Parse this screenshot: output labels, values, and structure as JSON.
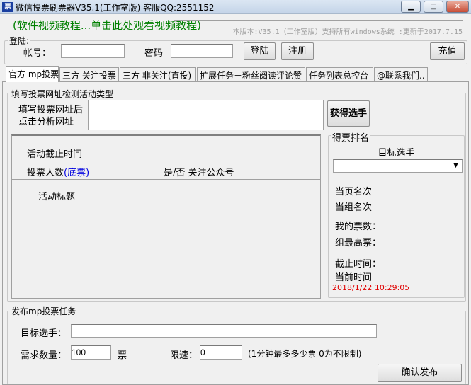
{
  "window": {
    "title": "微信投票刷票器V35.1(工作室版) 客服QQ:2551152",
    "icon": "app-icon",
    "minimize": "minimize-icon",
    "maximize": "maximize-icon",
    "close": "close-icon"
  },
  "header": {
    "video_link": "(软件视频教程...单击此处观看视频教程)",
    "version_note": "本版本:V35.1（工作室版）支持所有windows系统 :更新于2017.7.15"
  },
  "login": {
    "legend": "登陆:",
    "account_label": "帐号：",
    "account_value": "",
    "password_label": "密码",
    "password_value": "",
    "login_button": "登陆",
    "register_button": "注册",
    "recharge_button": "充值"
  },
  "tabs": [
    {
      "label": "官方 mp投票",
      "active": true
    },
    {
      "label": "三方 关注投票"
    },
    {
      "label": "三方 非关注(直投)"
    },
    {
      "label": "扩展任务－粉丝阅读评论赞"
    },
    {
      "label": "任务列表总控台"
    },
    {
      "label": "@联系我们.."
    }
  ],
  "detect": {
    "legend": "填写投票网址检测活动类型",
    "url_label_1": "填写投票网址后",
    "url_label_2": "点击分析网址",
    "url_value": "",
    "get_button": "获得选手",
    "deadline_label": "活动截止时间",
    "voters_label": "投票人数",
    "voters_link": "(底票)",
    "follow_label": "是/否 关注公众号",
    "title_label": "活动标题"
  },
  "ranking": {
    "legend": "得票排名",
    "target_label": "目标选手",
    "target_value": "",
    "page_rank": "当页名次",
    "group_rank": "当组名次",
    "my_votes": "我的票数：",
    "group_max": "组最高票：",
    "deadline": "截止时间：",
    "current_time": "当前时间",
    "timestamp": "2018/1/22 10:29:05",
    "timestamp_color": "#e00000"
  },
  "publish": {
    "legend": "发布mp投票任务",
    "target_label": "目标选手：",
    "target_value": "",
    "quantity_label": "需求数量：",
    "quantity_value": "100",
    "quantity_unit": "票",
    "speed_label": "限速：",
    "speed_value": "0",
    "speed_note": "(1分钟最多多少票 0为不限制)",
    "confirm_button": "确认发布"
  }
}
